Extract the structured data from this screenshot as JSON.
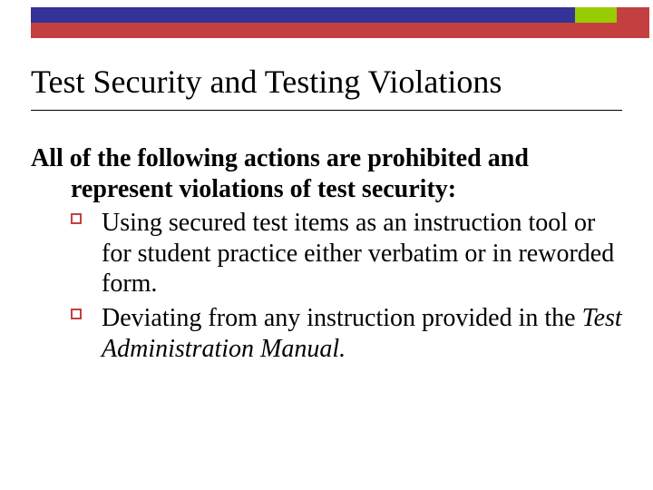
{
  "colors": {
    "band_primary": "#333399",
    "band_accent": "#99cc00",
    "band_secondary": "#c44040",
    "bullet_border": "#c44040"
  },
  "title": "Test Security and Testing Violations",
  "intro_line1": "All of the following actions are prohibited and",
  "intro_line2": "represent violations of test security:",
  "bullets": [
    {
      "text": "Using secured test items as an instruction tool or for student practice either verbatim or in reworded form."
    },
    {
      "prefix": "Deviating from any instruction provided in the ",
      "italic": "Test Administration Manual.",
      "suffix": ""
    }
  ]
}
